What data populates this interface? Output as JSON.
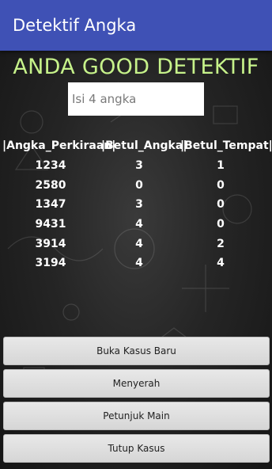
{
  "app": {
    "title": "Detektif Angka"
  },
  "headline": "ANDA GOOD DETEKTIF",
  "input": {
    "placeholder": "Isi 4 angka",
    "value": ""
  },
  "table": {
    "headers": [
      "|Angka_Perkiraan|",
      "|Betul_Angka|",
      "|Betul_Tempat|"
    ],
    "rows": [
      [
        "1234",
        "3",
        "1"
      ],
      [
        "2580",
        "0",
        "0"
      ],
      [
        "1347",
        "3",
        "0"
      ],
      [
        "9431",
        "4",
        "0"
      ],
      [
        "3914",
        "4",
        "2"
      ],
      [
        "3194",
        "4",
        "4"
      ]
    ]
  },
  "buttons": {
    "new_case": "Buka Kasus Baru",
    "give_up": "Menyerah",
    "instructions": "Petunjuk Main",
    "close_case": "Tutup Kasus"
  },
  "colors": {
    "appbar": "#3f51b5",
    "headline": "#c6f28a",
    "button": "#d6d6d6"
  }
}
